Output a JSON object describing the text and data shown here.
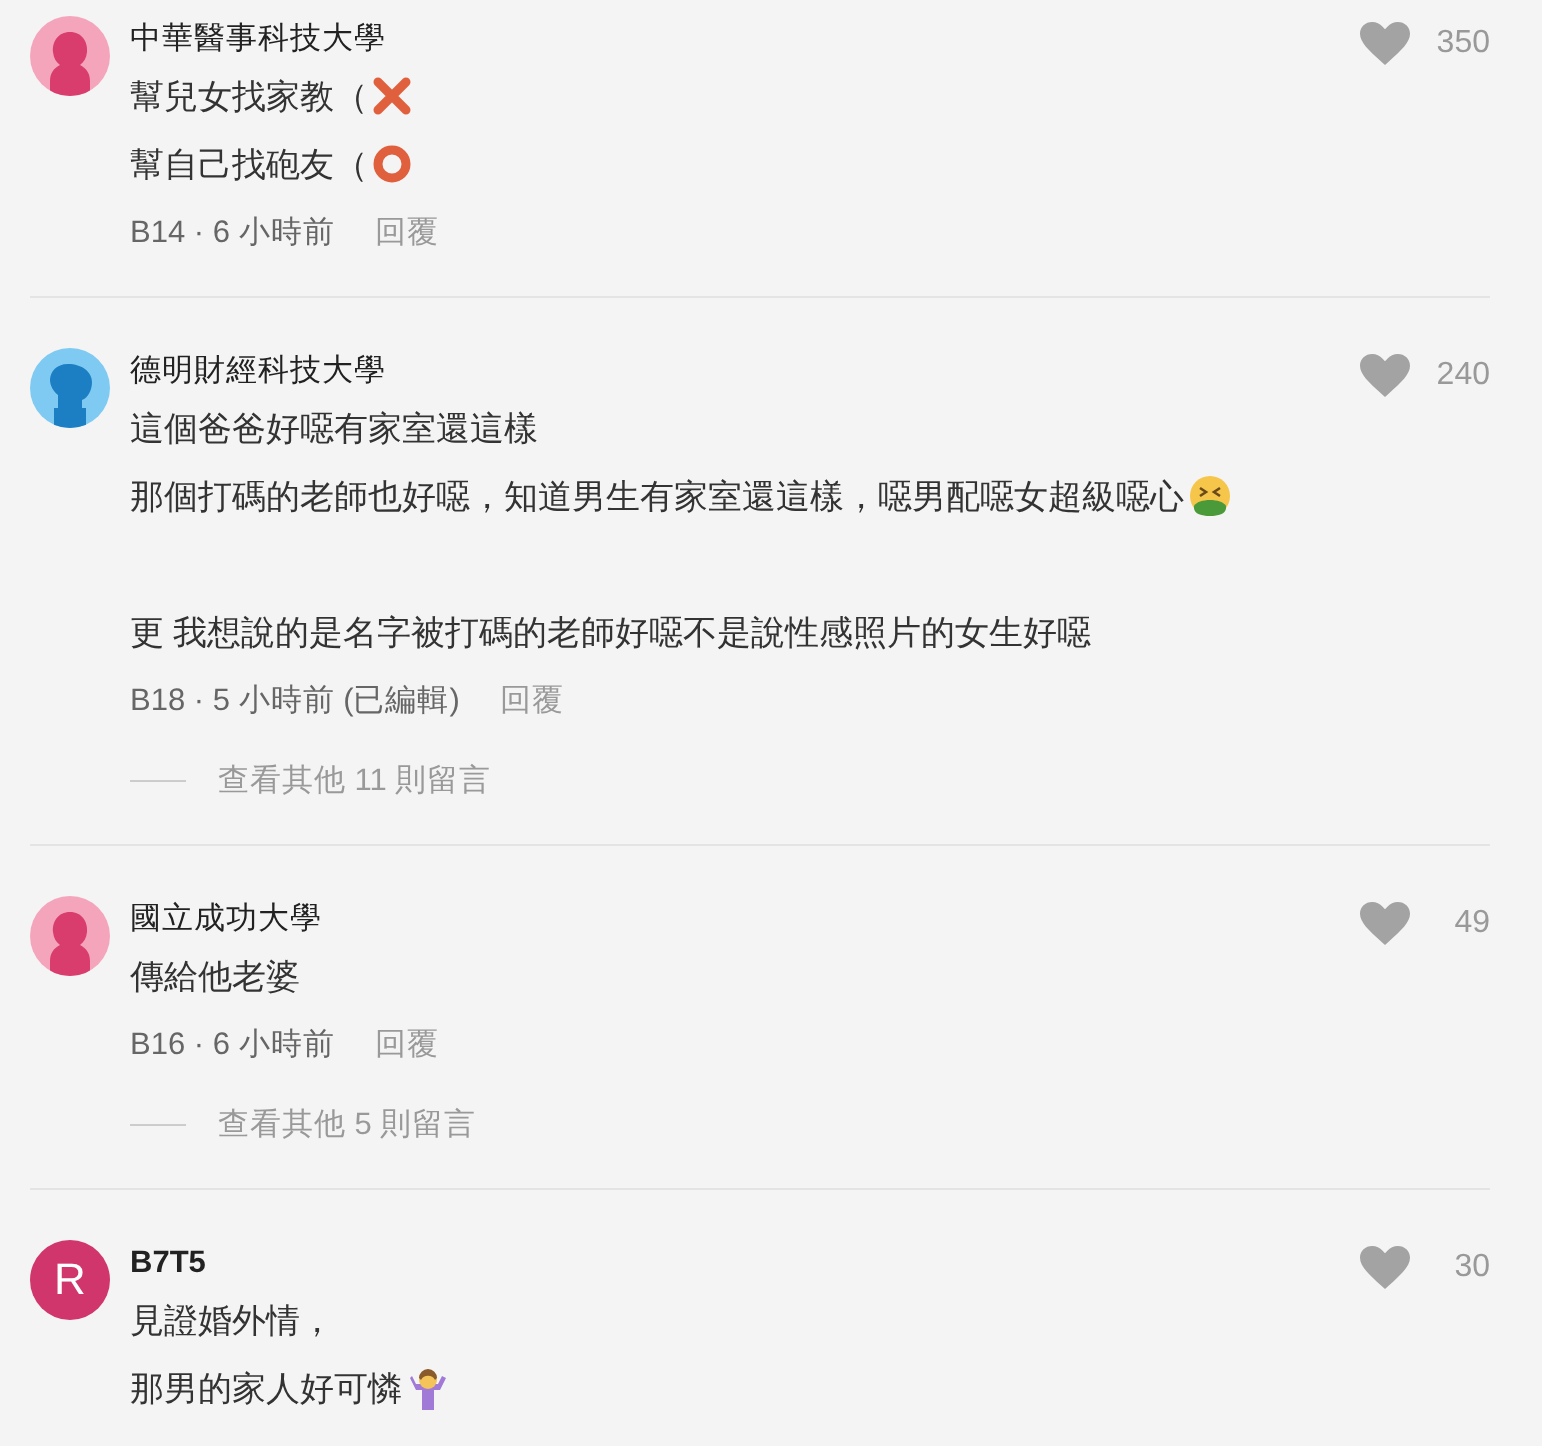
{
  "comments": [
    {
      "avatar": {
        "kind": "female"
      },
      "author": "中華醫事科技大學",
      "likes": "350",
      "lines": [
        {
          "text": "幫兒女找家教（",
          "kind": "cross",
          "gap_before": false
        },
        {
          "text": "幫自己找砲友（",
          "kind": "circle",
          "gap_before": false
        }
      ],
      "meta": "B14 · 6 小時前",
      "reply": "回覆"
    },
    {
      "avatar": {
        "kind": "male"
      },
      "author": "德明財經科技大學",
      "likes": "240",
      "lines": [
        {
          "text": "這個爸爸好噁有家室還這樣",
          "kind": "plain",
          "gap_before": false
        },
        {
          "text": "那個打碼的老師也好噁，知道男生有家室還這樣，噁男配噁女超級噁心",
          "kind": "nauseated",
          "gap_before": false
        },
        {
          "text": "更 我想說的是名字被打碼的老師好噁不是說性感照片的女生好噁",
          "kind": "plain",
          "gap_before": true
        }
      ],
      "meta": "B18 · 5 小時前 (已編輯)",
      "reply": "回覆",
      "more_replies": "查看其他 11 則留言"
    },
    {
      "avatar": {
        "kind": "female"
      },
      "author": "國立成功大學",
      "likes": "49",
      "lines": [
        {
          "text": "傳給他老婆",
          "kind": "plain",
          "gap_before": false
        }
      ],
      "meta": "B16 · 6 小時前",
      "reply": "回覆",
      "more_replies": "查看其他 5 則留言"
    },
    {
      "avatar": {
        "kind": "letter",
        "letter": "R"
      },
      "author": "B7T5",
      "likes": "30",
      "lines": [
        {
          "text": "見證婚外情，",
          "kind": "plain",
          "gap_before": false
        },
        {
          "text": "那男的家人好可憐",
          "kind": "shrug",
          "gap_before": false
        }
      ]
    }
  ]
}
